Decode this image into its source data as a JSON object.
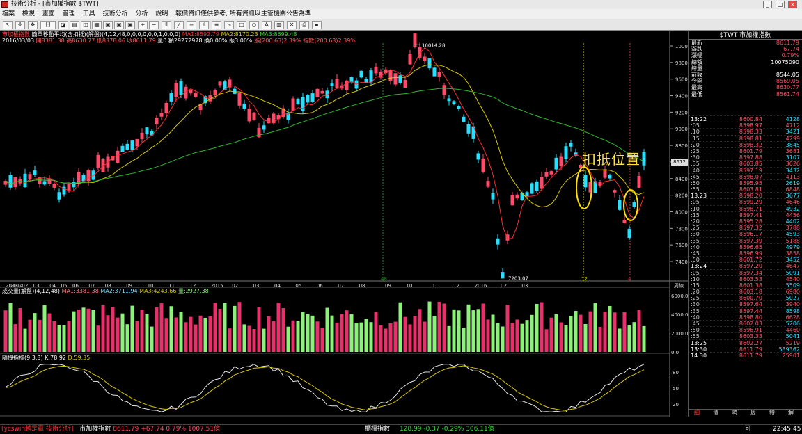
{
  "window": {
    "title": "技術分析 - [市加權指數 $TWT]",
    "min": "_",
    "max": "□",
    "close": "×"
  },
  "menu": [
    "檔案",
    "檢視",
    "畫面",
    "管理",
    "工具",
    "技術分析",
    "分析",
    "說明",
    "報價資訊僅供參考, 所有資訊以主管機關公告為準"
  ],
  "toolbar": {
    "period_label": "日"
  },
  "chart": {
    "header_line1": {
      "name": "市加權指數",
      "indicator": "簡單移動平均(含扣抵)(解盤)(4,12,48,0,0,0,0,0,0,1,0,0,0)",
      "ma1": "MA1:8592.79",
      "ma2": "MA2:8170.23",
      "ma3": "MA3:8699.48"
    },
    "header_line2": {
      "date": "2016/03/03",
      "open": "開8381.38",
      "high": "高8630.77",
      "low": "低8378.06",
      "close": "收8611.79",
      "volume": "量0",
      "amount": "額29272978",
      "change": "換0.00%",
      "chg": "振3.00%",
      "ratio": "漲(200.63)2.39%",
      "ratio2": "指數(200.63)2.39%"
    },
    "annotation": "扣抵位置",
    "high_label": "10014.28",
    "low_label": "7203.07",
    "last_price_tag": "8612",
    "yaxis": [
      "10000",
      "9800",
      "9600",
      "9400",
      "9200",
      "9000",
      "8800",
      "8600",
      "8400",
      "8200",
      "8000",
      "7800",
      "7600",
      "7400"
    ],
    "xaxis": [
      "2013",
      "2014",
      "02",
      "03",
      "04",
      "05",
      "06",
      "07",
      "08",
      "09",
      "10",
      "11",
      "12",
      "2015",
      "02",
      "03",
      "04",
      "05",
      "06",
      "07",
      "08",
      "09",
      "10",
      "11",
      "12",
      "2016",
      "02",
      "03"
    ],
    "vline_labels": [
      "48",
      "12",
      "4"
    ],
    "unit_label": "周線",
    "volume": {
      "header": "成交量(解盤)(4,12,48)",
      "ma1": "MA1:3381.38",
      "ma2": "MA2:3711.94",
      "ma3": "MA3:4243.66",
      "vol": "量:2927.38",
      "yaxis": [
        "6000.0",
        "4000.0",
        "2000.0",
        "0.0"
      ]
    },
    "kd": {
      "header": "隨機指標(9,3,3)",
      "k": "K:78.92",
      "d": "D:59.35",
      "yaxis": [
        "80",
        "50",
        "20"
      ]
    }
  },
  "quote": {
    "header": "$TWT 市加權指數",
    "rows": [
      {
        "k": "最新",
        "v": "8611.79",
        "c": "#ff4a5a"
      },
      {
        "k": "漲跌",
        "v": "67.74",
        "c": "#ff4a5a"
      },
      {
        "k": "漲幅",
        "v": "0.79%",
        "c": "#ff4a5a"
      },
      {
        "k": "總額",
        "v": "10075090",
        "c": "#ffffff"
      },
      {
        "k": "總量",
        "v": "",
        "c": "#ffffff"
      },
      {
        "k": "前收",
        "v": "8544.05",
        "c": "#ffffff"
      },
      {
        "k": "今開",
        "v": "8569.05",
        "c": "#ff4a5a"
      },
      {
        "k": "最高",
        "v": "8630.77",
        "c": "#ff4a5a"
      },
      {
        "k": "最低",
        "v": "8561.74",
        "c": "#ff4a5a"
      }
    ],
    "ticks": [
      {
        "t": "13:22",
        "p": "8600.84",
        "q": "4128"
      },
      {
        "t": ":05",
        "p": "8598.97",
        "q": "4712"
      },
      {
        "t": ":10",
        "p": "8598.33",
        "q": "3421"
      },
      {
        "t": ":15",
        "p": "8598.81",
        "q": "4299"
      },
      {
        "t": ":20",
        "p": "8598.32",
        "q": "3845"
      },
      {
        "t": ":25",
        "p": "8601.79",
        "q": "3681"
      },
      {
        "t": ":30",
        "p": "8597.88",
        "q": "3107"
      },
      {
        "t": ":35",
        "p": "8603.85",
        "q": "3026"
      },
      {
        "t": ":40",
        "p": "8597.19",
        "q": "3432"
      },
      {
        "t": ":45",
        "p": "8598.07",
        "q": "4113"
      },
      {
        "t": ":50",
        "p": "8595.95",
        "q": "2619"
      },
      {
        "t": ":55",
        "p": "8603.81",
        "q": "6848"
      },
      {
        "t": "13:23",
        "p": "8598.20",
        "q": "3677"
      },
      {
        "t": ":05",
        "p": "8599.29",
        "q": "4646"
      },
      {
        "t": ":10",
        "p": "8598.71",
        "q": "4932"
      },
      {
        "t": ":15",
        "p": "8597.41",
        "q": "4456"
      },
      {
        "t": ":20",
        "p": "8595.28",
        "q": "4402"
      },
      {
        "t": ":25",
        "p": "8597.32",
        "q": "3788"
      },
      {
        "t": ":30",
        "p": "8596.17",
        "q": "4593"
      },
      {
        "t": ":35",
        "p": "8597.39",
        "q": "5188"
      },
      {
        "t": ":40",
        "p": "8596.65",
        "q": "4979"
      },
      {
        "t": ":45",
        "p": "8596.99",
        "q": "3858"
      },
      {
        "t": ":50",
        "p": "8601.72",
        "q": "3452"
      },
      {
        "t": "13:24",
        "p": "8597.20",
        "q": "4647"
      },
      {
        "t": ":05",
        "p": "8597.34",
        "q": "5091"
      },
      {
        "t": ":10",
        "p": "8603.53",
        "q": "4540"
      },
      {
        "t": ":15",
        "p": "8601.38",
        "q": "5509"
      },
      {
        "t": ":20",
        "p": "8603.18",
        "q": "6980"
      },
      {
        "t": ":25",
        "p": "8600.70",
        "q": "5027"
      },
      {
        "t": ":30",
        "p": "8597.64",
        "q": "3940"
      },
      {
        "t": ":35",
        "p": "8597.44",
        "q": "8598"
      },
      {
        "t": ":40",
        "p": "8598.80",
        "q": "6628"
      },
      {
        "t": ":45",
        "p": "8602.03",
        "q": "5206"
      },
      {
        "t": ":50",
        "p": "8596.91",
        "q": "4460"
      },
      {
        "t": ":55",
        "p": "8603.33",
        "q": "5041"
      },
      {
        "t": "13:25",
        "p": "8602.27",
        "q": "5219"
      },
      {
        "t": "13:30",
        "p": "8611.79",
        "q": "539362"
      },
      {
        "t": "14:30",
        "p": "8611.79",
        "q": "25901"
      }
    ],
    "tabs": [
      "細",
      "價",
      "勢",
      "周",
      "特",
      "解"
    ]
  },
  "status": {
    "brand": "[ycswin越是贏 技術分析]",
    "idx1_name": "市加權指數",
    "idx1_val": "8611.79 +67.74 0.79% 1007.51億",
    "idx2_name": "櫃檯指數",
    "idx2_val": "128.99 -0.37 -0.29% 306.11億",
    "conn": "可",
    "time": "22:45:45"
  },
  "colors": {
    "up": "#ff4a6a",
    "down": "#27e0ff",
    "ma_red": "#ff3030",
    "ma_yellow": "#d8c800",
    "ma_green": "#2fb52f",
    "vol_up": "#e8306a",
    "vol_down": "#8cf27a",
    "k_line": "#e8e8e8",
    "d_line": "#d8c800"
  }
}
